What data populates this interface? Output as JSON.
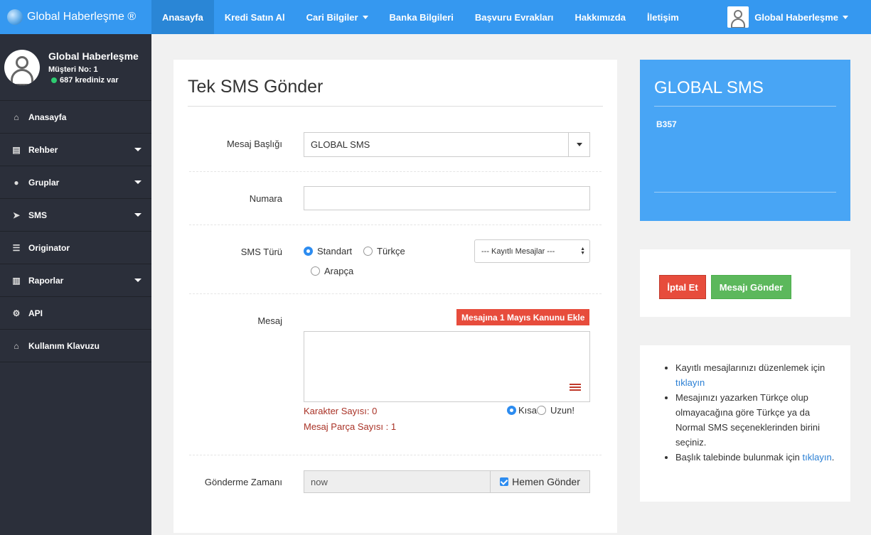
{
  "brand": {
    "name": "Global Haberleşme ®"
  },
  "topnav": {
    "items": [
      {
        "label": "Anasayfa",
        "active": true
      },
      {
        "label": "Kredi Satın Al"
      },
      {
        "label": "Cari Bilgiler",
        "dropdown": true
      },
      {
        "label": "Banka Bilgileri"
      },
      {
        "label": "Başvuru Evrakları"
      },
      {
        "label": "Hakkımızda"
      },
      {
        "label": "İletişim"
      }
    ],
    "user": "Global Haberleşme"
  },
  "sidebar": {
    "profile": {
      "name": "Global Haberleşme",
      "customer_no": "Müşteri No: 1",
      "credits": "687 krediniz var"
    },
    "items": [
      {
        "label": "Anasayfa",
        "icon": "home-icon"
      },
      {
        "label": "Rehber",
        "icon": "book-icon",
        "dropdown": true
      },
      {
        "label": "Gruplar",
        "icon": "users-icon",
        "dropdown": true
      },
      {
        "label": "SMS",
        "icon": "paper-plane-icon",
        "dropdown": true
      },
      {
        "label": "Originator",
        "icon": "list-icon"
      },
      {
        "label": "Raporlar",
        "icon": "bar-chart-icon",
        "dropdown": true
      },
      {
        "label": "API",
        "icon": "gear-icon"
      },
      {
        "label": "Kullanım Klavuzu",
        "icon": "bank-icon"
      }
    ]
  },
  "form": {
    "title": "Tek SMS Gönder",
    "header_label": "Mesaj Başlığı",
    "header_value": "GLOBAL SMS",
    "number_label": "Numara",
    "number_value": "",
    "type_label": "SMS Türü",
    "type_options": [
      "Standart",
      "Türkçe",
      "Arapça"
    ],
    "type_selected": "Standart",
    "saved_messages": "--- Kayıtlı Mesajlar ---",
    "message_label": "Mesaj",
    "may_day_button": "Mesajına 1 Mayıs Kanunu Ekle",
    "message_value": "",
    "char_count": "Karakter Sayısı: 0",
    "part_count": "Mesaj Parça Sayısı : 1",
    "length_options": [
      "Kısa",
      "Uzun!"
    ],
    "length_selected": "Kısa",
    "schedule_label": "Gönderme Zamanı",
    "schedule_value": "now",
    "send_now_label": "Hemen Gönder",
    "send_now_checked": true
  },
  "summary": {
    "title": "GLOBAL SMS",
    "code": "B357"
  },
  "actions": {
    "cancel": "İptal Et",
    "send": "Mesajı Gönder"
  },
  "info": {
    "items": [
      {
        "text": "Kayıtlı mesajlarınızı düzenlemek için",
        "link": "tıklayın"
      },
      {
        "text": "Mesajınızı yazarken Türkçe olup olmayacağına göre Türkçe ya da Normal SMS seçeneklerinden birini seçiniz."
      },
      {
        "text": "Başlık talebinde bulunmak için",
        "link": "tıklayın",
        "suffix": "."
      }
    ]
  },
  "colors": {
    "primary": "#3598f0",
    "sidebar": "#2b2f3a",
    "danger": "#e74c3c",
    "success": "#5cb85c",
    "summary_card": "#48a5f5"
  }
}
